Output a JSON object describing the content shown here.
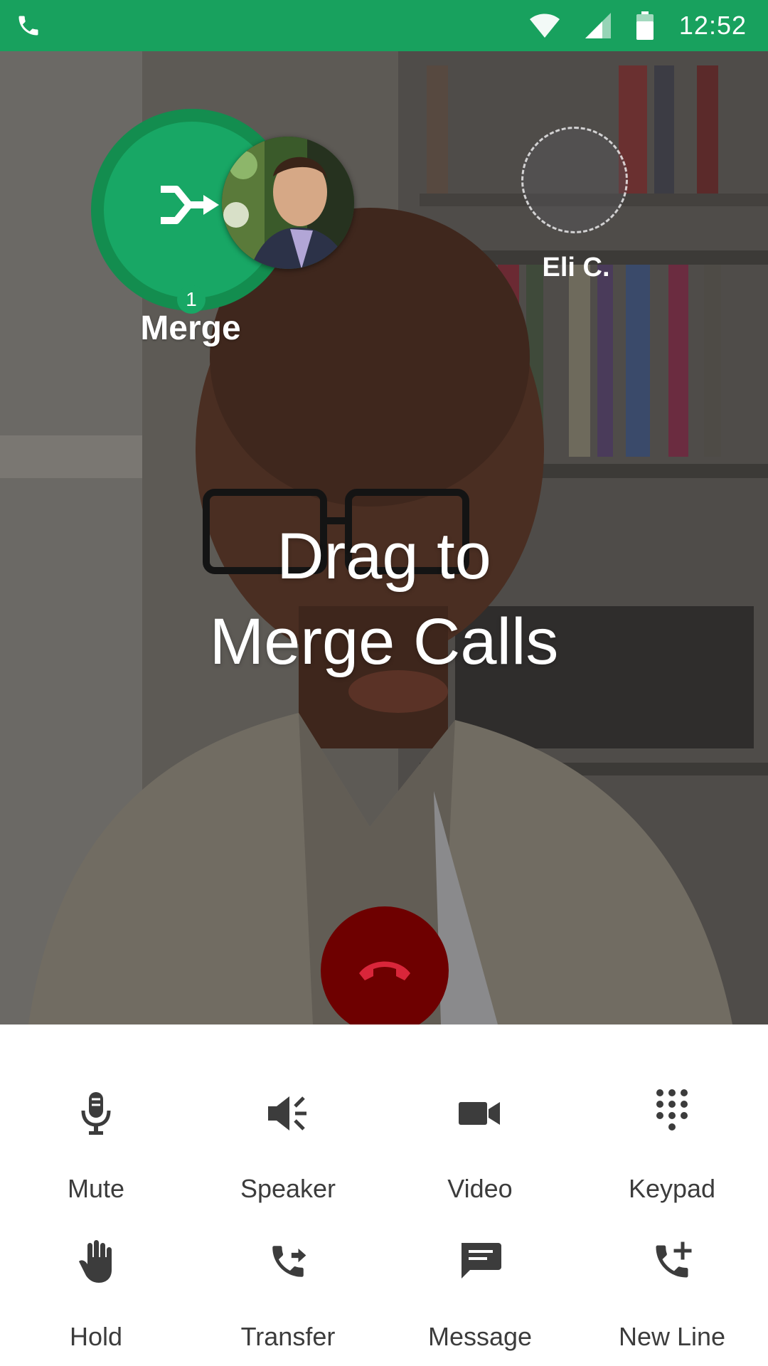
{
  "status_bar": {
    "time": "12:52",
    "icons": [
      "phone-call-icon",
      "wifi-icon",
      "cell-signal-icon",
      "battery-icon"
    ],
    "background": "#18a15e"
  },
  "merge": {
    "label": "Merge",
    "badge_count": "1",
    "color": "#18a765"
  },
  "second_call": {
    "name": "Eli C."
  },
  "hint": {
    "line1": "Drag to",
    "line2": "Merge Calls"
  },
  "end_call": {
    "icon": "hang-up-icon",
    "color": "#6e0000"
  },
  "actions": [
    {
      "label": "Mute",
      "icon": "microphone-icon"
    },
    {
      "label": "Speaker",
      "icon": "speaker-icon"
    },
    {
      "label": "Video",
      "icon": "video-camera-icon"
    },
    {
      "label": "Keypad",
      "icon": "keypad-icon"
    },
    {
      "label": "Hold",
      "icon": "hand-icon"
    },
    {
      "label": "Transfer",
      "icon": "transfer-call-icon"
    },
    {
      "label": "Message",
      "icon": "message-icon"
    },
    {
      "label": "New Line",
      "icon": "add-call-icon"
    }
  ]
}
